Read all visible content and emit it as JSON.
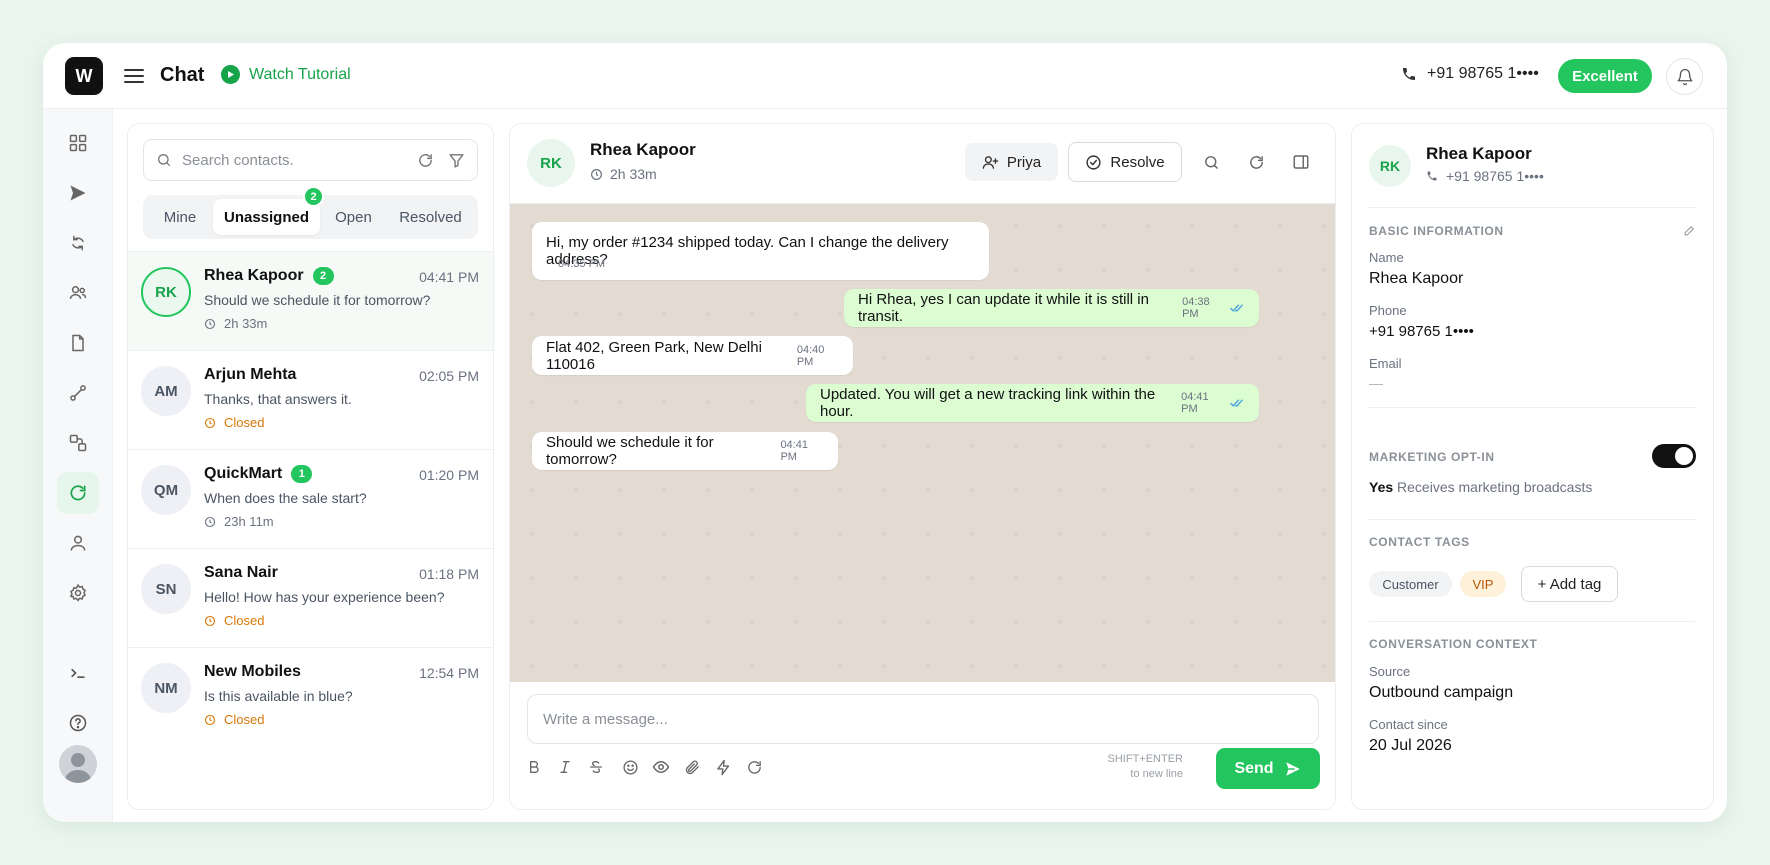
{
  "header": {
    "logo_letter": "W",
    "title": "Chat",
    "tutorial_label": "Watch Tutorial",
    "phone": "+91 98765 1••••",
    "status_badge": "Excellent"
  },
  "contacts": {
    "search_placeholder": "Search contacts.",
    "tabs": [
      {
        "label": "Mine"
      },
      {
        "label": "Unassigned",
        "badge": "2"
      },
      {
        "label": "Open"
      },
      {
        "label": "Resolved"
      }
    ],
    "items": [
      {
        "initials": "RK",
        "name": "Rhea Kapoor",
        "badge": "2",
        "time": "04:41 PM",
        "preview": "Should we schedule it for tomorrow?",
        "meta": "2h 33m"
      },
      {
        "initials": "AM",
        "name": "Arjun Mehta",
        "time": "02:05 PM",
        "preview": "Thanks, that answers it.",
        "meta": "Closed"
      },
      {
        "initials": "QM",
        "name": "QuickMart",
        "badge": "1",
        "time": "01:20 PM",
        "preview": "When does the sale start?",
        "meta": "23h 11m"
      },
      {
        "initials": "SN",
        "name": "Sana Nair",
        "time": "01:18 PM",
        "preview": "Hello! How has your experience been?",
        "meta": "Closed"
      },
      {
        "initials": "NM",
        "name": "New Mobiles",
        "time": "12:54 PM",
        "preview": "Is this available in blue?",
        "meta": "Closed"
      }
    ]
  },
  "chat": {
    "initials": "RK",
    "name": "Rhea Kapoor",
    "duration": "2h 33m",
    "assignee_label": "Priya",
    "resolve_label": "Resolve",
    "messages": [
      {
        "text": "Hi, my order #1234 shipped today. Can I change the delivery address?",
        "time": "04:35 PM"
      },
      {
        "text": "Hi Rhea, yes I can update it while it is still in transit.",
        "time": "04:38 PM"
      },
      {
        "text": "Flat 402, Green Park, New Delhi 110016",
        "time": "04:40 PM"
      },
      {
        "text": "Updated. You will get a new tracking link within the hour.",
        "time": "04:41 PM"
      },
      {
        "text": "Should we schedule it for tomorrow?",
        "time": "04:41 PM"
      }
    ],
    "input_placeholder": "Write a message...",
    "hint_line1": "SHIFT+ENTER",
    "hint_line2": "to new line",
    "send_label": "Send"
  },
  "info": {
    "initials": "RK",
    "name": "Rhea Kapoor",
    "phone": "+91 98765 1••••",
    "basic_title": "BASIC INFORMATION",
    "name_label": "Name",
    "name_value": "Rhea Kapoor",
    "phone_label": "Phone",
    "phone_value": "+91 98765 1••••",
    "email_label": "Email",
    "email_value": "—",
    "marketing_title": "MARKETING OPT-IN",
    "marketing_yes": "Yes",
    "marketing_desc": "Receives marketing broadcasts",
    "tags_title": "CONTACT TAGS",
    "tags": [
      "Customer",
      "VIP"
    ],
    "add_tag_label": "+ Add tag",
    "context_title": "CONVERSATION CONTEXT",
    "source_label": "Source",
    "source_value": "Outbound campaign",
    "since_label": "Contact since",
    "since_value": "20 Jul 2026"
  },
  "colors": {
    "accent": "#22c55e",
    "accent_dark": "#16a34a",
    "closed": "#d97706",
    "chat_bg": "#e3dad1",
    "outgoing_bubble": "#dcfcd2"
  }
}
